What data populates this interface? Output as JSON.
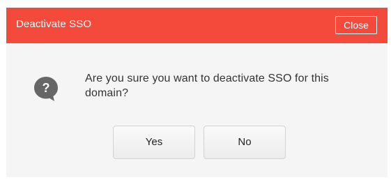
{
  "dialog": {
    "title": "Deactivate SSO",
    "close_label": "Close",
    "message": "Are you sure you want to deactivate SSO for this domain?",
    "icon": "question-icon",
    "buttons": {
      "yes_label": "Yes",
      "no_label": "No"
    }
  },
  "colors": {
    "header_background": "#f44a3c",
    "dialog_background": "#f5f5f5",
    "icon_color": "#666666"
  }
}
